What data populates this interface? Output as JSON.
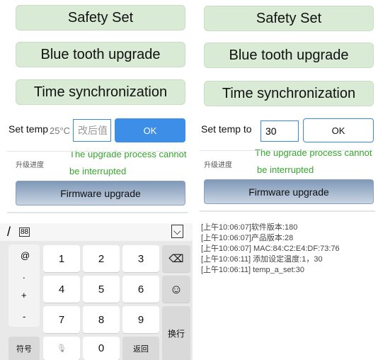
{
  "buttons": {
    "safety_set": "Safety Set",
    "bluetooth_upgrade": "Blue tooth upgrade",
    "time_sync": "Time synchronization",
    "ok": "OK",
    "firmware_upgrade": "Firmware upgrade"
  },
  "left": {
    "set_temp_label": "Set temp",
    "temp_hint": "25°C",
    "input_placeholder": "改后值"
  },
  "right": {
    "set_temp_label": "Set temp to",
    "input_value": "30"
  },
  "notice_line1": "The upgrade process cannot",
  "notice_line2": "be interrupted",
  "progress_label": "升级进度",
  "keyboard": {
    "top_left_glyph": "/",
    "grid_icon": "88",
    "collapse_icon": "⌵",
    "side_symbols": [
      "@",
      ".",
      "+",
      "-"
    ],
    "row1": [
      "1",
      "2",
      "3"
    ],
    "row2": [
      "4",
      "5",
      "6"
    ],
    "row3": [
      "7",
      "8",
      "9"
    ],
    "symbols_key": "符号",
    "zero_key": "0",
    "back_key": "返回",
    "enter_key": "换行",
    "backspace_icon": "⌫",
    "emoji_icon": "☺",
    "mic_icon": "🎙"
  },
  "log_lines": [
    "[上午10:06:07]软件版本:180",
    "[上午10:06:07]产品版本:28",
    "[上午10:06:07] MAC:84:C2:E4:DF:73:76",
    "[上午10:06:11] 添加设定温度:1，30",
    "[上午10:06:11] temp_a_set:30"
  ]
}
